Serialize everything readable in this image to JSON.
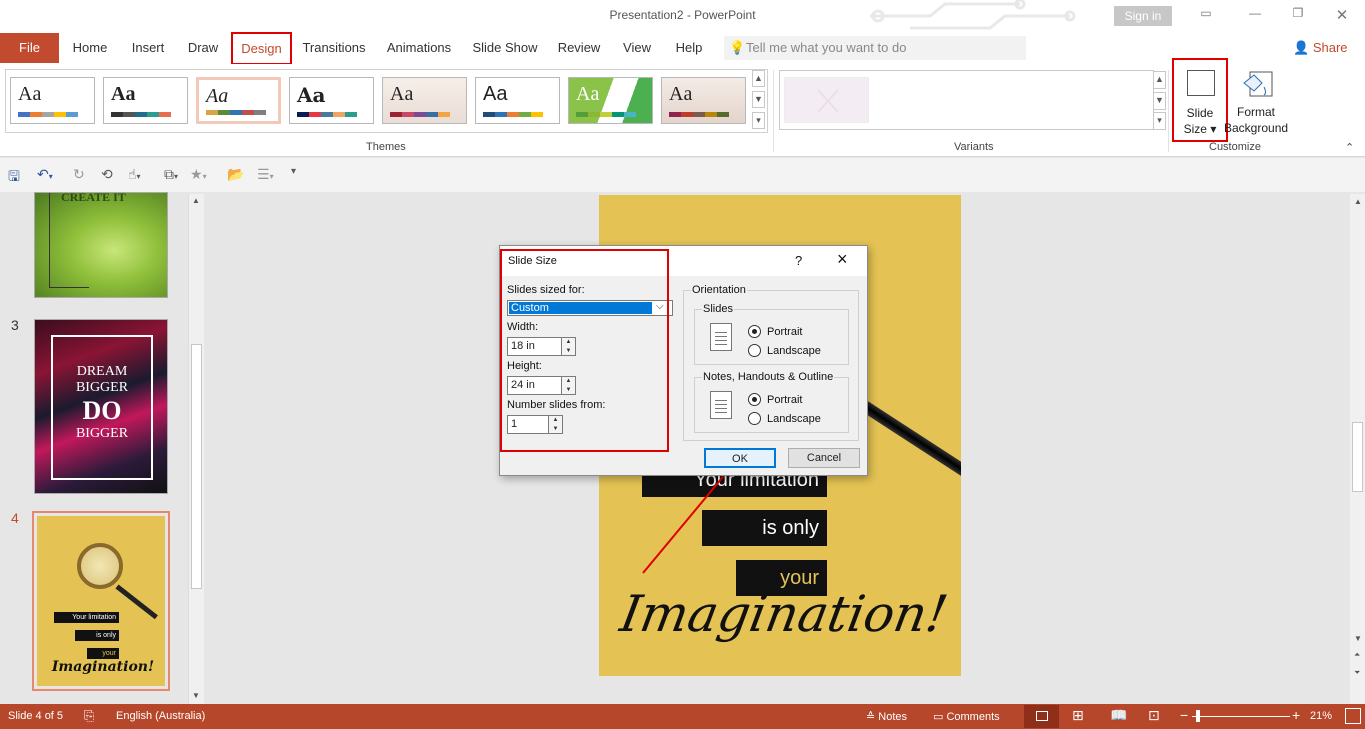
{
  "titlebar": {
    "title": "Presentation2  -  PowerPoint",
    "signin": "Sign in"
  },
  "tabs": [
    "File",
    "Home",
    "Insert",
    "Draw",
    "Design",
    "Transitions",
    "Animations",
    "Slide Show",
    "Review",
    "View",
    "Help"
  ],
  "tell_me": "Tell me what you want to do",
  "share": "Share",
  "ribbon": {
    "themes_label": "Themes",
    "variants_label": "Variants",
    "customize_label": "Customize",
    "slide_size": {
      "line1": "Slide",
      "line2": "Size"
    },
    "format_background": {
      "line1": "Format",
      "line2": "Background"
    },
    "theme_sample": "Aa"
  },
  "thumbnails": {
    "slide2_text": "CREATE IT",
    "slide3_number": "3",
    "slide3_lines": [
      "DREAM",
      "BIGGER",
      "DO",
      "BIGGER"
    ],
    "slide4_number": "4",
    "slide4_lines": [
      "Your limitation",
      "is only",
      "your",
      "Imagination!"
    ]
  },
  "slide": {
    "line1": "Your limitation",
    "line2": "is only",
    "line3": "your",
    "line4": "Imagination!"
  },
  "dialog": {
    "title": "Slide Size",
    "help": "?",
    "close": "×",
    "sized_for_label": "Slides sized for:",
    "sized_for_value": "Custom",
    "width_label": "Width:",
    "width_value": "18 in",
    "height_label": "Height:",
    "height_value": "24 in",
    "number_from_label": "Number slides from:",
    "number_from_value": "1",
    "orientation_label": "Orientation",
    "slides_group": "Slides",
    "slides_portrait": "Portrait",
    "slides_landscape": "Landscape",
    "notes_group": "Notes, Handouts & Outline",
    "notes_portrait": "Portrait",
    "notes_landscape": "Landscape",
    "ok": "OK",
    "cancel": "Cancel"
  },
  "statusbar": {
    "slide_info": "Slide 4 of 5",
    "language": "English (Australia)",
    "notes": "Notes",
    "comments": "Comments",
    "zoom": "21%"
  },
  "colors": {
    "accent": "#b7472a",
    "highlight_box": "#e00000",
    "slide_bg": "#e4c354"
  }
}
